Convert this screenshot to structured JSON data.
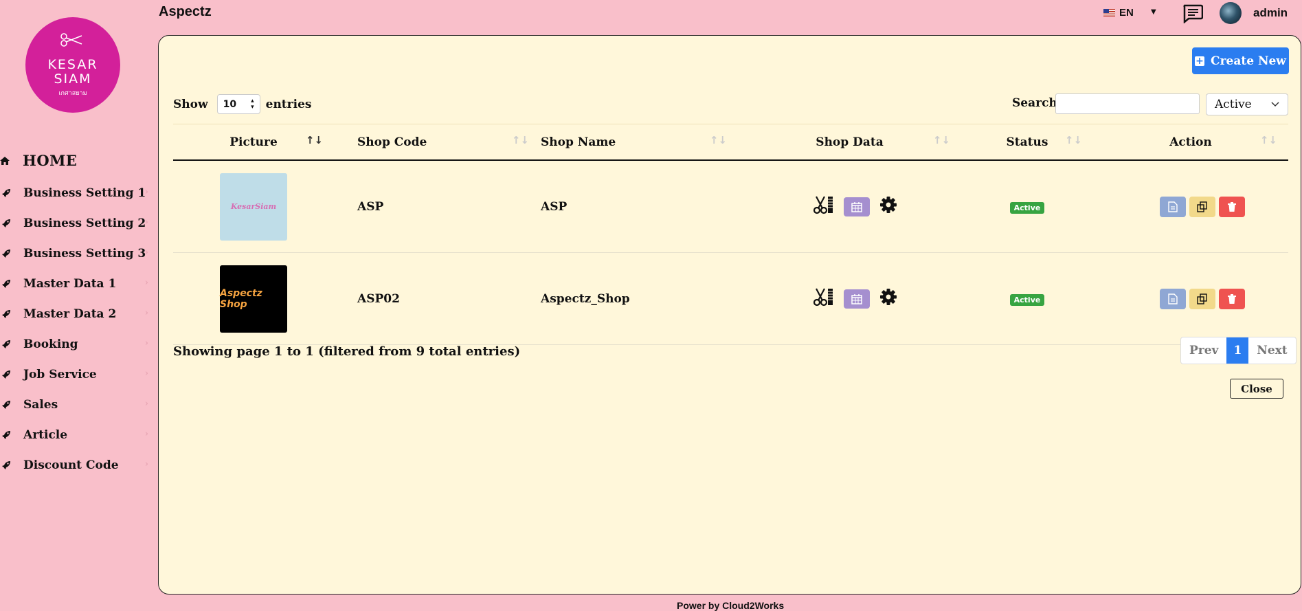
{
  "app": {
    "title": "Aspectz",
    "user": "admin",
    "language": "EN"
  },
  "logo": {
    "line1": "KESAR",
    "line2": "SIAM",
    "line3": "เกศาสยาม"
  },
  "sidebar": {
    "home": "HOME",
    "items": [
      {
        "label": "Business Setting 1",
        "icon": "rocket-icon"
      },
      {
        "label": "Business Setting 2",
        "icon": "rocket-icon"
      },
      {
        "label": "Business Setting 3",
        "icon": "rocket-icon"
      },
      {
        "label": "Master Data 1",
        "icon": "rocket-icon"
      },
      {
        "label": "Master Data 2",
        "icon": "rocket-icon"
      },
      {
        "label": "Booking",
        "icon": "rocket-icon"
      },
      {
        "label": "Job Service",
        "icon": "rocket-icon"
      },
      {
        "label": "Sales",
        "icon": "rocket-icon"
      },
      {
        "label": "Article",
        "icon": "rocket-icon"
      },
      {
        "label": "Discount Code",
        "icon": "rocket-icon"
      }
    ]
  },
  "toolbar": {
    "create_label": "Create New",
    "show_label": "Show",
    "entries_value": "10",
    "entries_label": "entries",
    "search_label": "Search",
    "search_value": "",
    "status_filter": "Active"
  },
  "table": {
    "headers": [
      "Picture",
      "Shop Code",
      "Shop Name",
      "Shop Data",
      "Status",
      "Action"
    ],
    "rows": [
      {
        "picture_text": "KesarSiam",
        "code": "ASP",
        "name": "ASP",
        "status": "Active"
      },
      {
        "picture_text": "Aspectz Shop",
        "code": "ASP02",
        "name": "Aspectz_Shop",
        "status": "Active"
      }
    ]
  },
  "pagination": {
    "info": "Showing page 1 to 1 (filtered from 9 total entries)",
    "prev": "Prev",
    "current": "1",
    "next": "Next"
  },
  "close_label": "Close",
  "footer": "Power by Cloud2Works",
  "colors": {
    "accent": "#2b7df0",
    "sidebar_bg": "#f9bfca",
    "panel_bg": "#fff7da",
    "active_badge": "#37a441",
    "delete": "#ef5350"
  }
}
